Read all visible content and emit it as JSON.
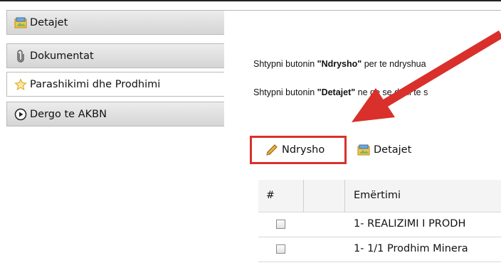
{
  "sidebar": {
    "items": [
      {
        "label": "Detajet",
        "icon": "details-icon"
      },
      {
        "label": "Dokumentat",
        "icon": "paperclip-icon"
      },
      {
        "label": "Parashikimi dhe Prodhimi",
        "icon": "star-icon",
        "active": true
      },
      {
        "label": "Dergo te AKBN",
        "icon": "play-circle-icon"
      }
    ]
  },
  "instructions": {
    "line1_prefix": "Shtypni butonin ",
    "line1_bold": "\"Ndrysho\"",
    "line1_suffix": " per te ndryshua",
    "line2_prefix": "Shtypni butonin ",
    "line2_bold": "\"Detajet\"",
    "line2_suffix": " ne qe se doni te s"
  },
  "toolbar": {
    "edit_label": "Ndrysho",
    "details_label": "Detajet"
  },
  "table": {
    "headers": [
      "#",
      "Emërtimi"
    ],
    "rows": [
      {
        "name": "1- REALIZIMI I PRODH"
      },
      {
        "name": "1- 1/1 Prodhim Minera"
      }
    ]
  },
  "colors": {
    "highlight": "#d9302b",
    "arrow": "#d9302b"
  }
}
